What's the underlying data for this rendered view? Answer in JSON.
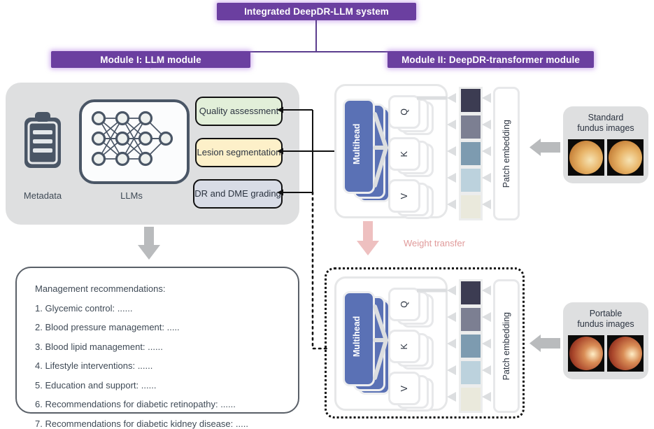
{
  "title_bar": {
    "label": "Integrated DeepDR-LLM system"
  },
  "modules": {
    "left": {
      "label": "Module I: LLM module"
    },
    "right": {
      "label": "Module II: DeepDR-transformer module"
    }
  },
  "llm_module": {
    "metadata_label": "Metadata",
    "llms_label": "LLMs",
    "tasks": [
      {
        "label": "Quality assessment",
        "color": "#e2efd9"
      },
      {
        "label": "Lesion segmentation",
        "color": "#fdf0c9"
      },
      {
        "label": "DR and DME grading",
        "color": "#d8dce6"
      }
    ]
  },
  "recommendations": {
    "heading": "Management recommendations:",
    "items": [
      "1. Glycemic control: ......",
      "2. Blood pressure management: .....",
      "3. Blood lipid management:  ......",
      "4. Lifestyle interventions:  ......",
      "5. Education and support:  ......",
      "6. Recommendations for diabetic retinopathy:  ......",
      "7. Recommendations for diabetic kidney disease: ....."
    ]
  },
  "transformer": {
    "multihead_label": "Multihead",
    "qkv": [
      "Q",
      "K",
      "V"
    ],
    "patch_embedding_label": "Patch embedding",
    "patch_colors": [
      "#3c3c52",
      "#7c7f92",
      "#7d9bb0",
      "#bcd2dd",
      "#eae9dc"
    ]
  },
  "weight_transfer": {
    "label": "Weight transfer",
    "color": "#e09a9a"
  },
  "fundus": {
    "standard": {
      "line1": "Standard",
      "line2": "fundus images"
    },
    "portable": {
      "line1": "Portable",
      "line2": "fundus images"
    }
  },
  "colors": {
    "purple": "#6b3fa0",
    "panel_grey": "#dedfe0",
    "multihead_blue": "#5a71b5",
    "arrow_grey": "#b9bbbd"
  }
}
